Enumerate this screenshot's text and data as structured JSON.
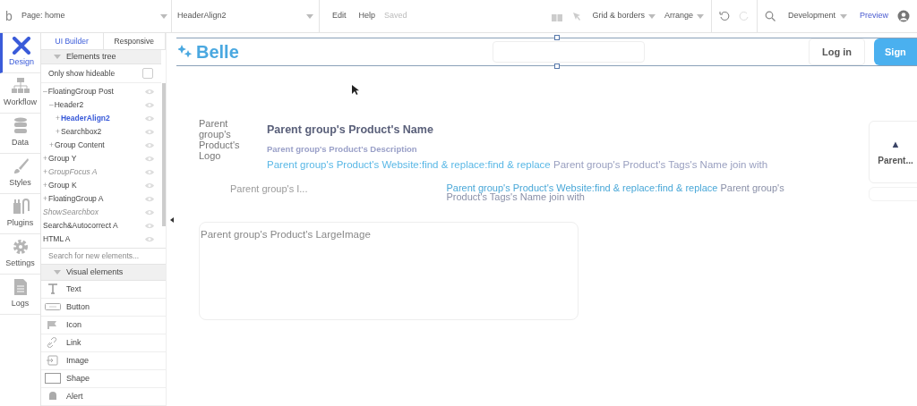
{
  "topbar": {
    "logo": "b",
    "page_select": "Page: home",
    "element_select": "HeaderAlign2",
    "menus": [
      "Edit",
      "Help"
    ],
    "save_status": "Saved",
    "grid_menu": "Grid & borders",
    "arrange_menu": "Arrange",
    "env_menu": "Development",
    "preview": "Preview"
  },
  "rail": [
    {
      "label": "Design",
      "selected": true
    },
    {
      "label": "Workflow",
      "selected": false
    },
    {
      "label": "Data",
      "selected": false
    },
    {
      "label": "Styles",
      "selected": false
    },
    {
      "label": "Plugins",
      "selected": false
    },
    {
      "label": "Settings",
      "selected": false
    },
    {
      "label": "Logs",
      "selected": false
    }
  ],
  "panel_tabs": [
    {
      "label": "UI Builder",
      "selected": true
    },
    {
      "label": "Responsive",
      "selected": false
    }
  ],
  "elements_tree": {
    "title": "Elements tree",
    "filter": {
      "label": "Only show hideable",
      "checked": false
    },
    "items": [
      {
        "marker": "–",
        "label": "FloatingGroup Post",
        "selected": false,
        "hidden": false,
        "children": [
          {
            "marker": "–",
            "label": "Header2",
            "selected": false,
            "hidden": false,
            "children": [
              {
                "marker": "+",
                "label": "HeaderAlign2",
                "selected": true,
                "hidden": false
              },
              {
                "marker": "+",
                "label": "Searchbox2",
                "selected": false,
                "hidden": false
              }
            ]
          },
          {
            "marker": "+",
            "label": "Group Content",
            "selected": false,
            "hidden": false
          }
        ]
      },
      {
        "marker": "+",
        "label": "Group Y",
        "selected": false,
        "hidden": false
      },
      {
        "marker": "+",
        "label": "GroupFocus A",
        "selected": false,
        "hidden": true
      },
      {
        "marker": "+",
        "label": "Group K",
        "selected": false,
        "hidden": false
      },
      {
        "marker": "+",
        "label": "FloatingGroup A",
        "selected": false,
        "hidden": false
      },
      {
        "label": "ShowSearchbox",
        "selected": false,
        "hidden": true
      },
      {
        "label": "Search&Autocorrect A",
        "selected": false,
        "hidden": false
      },
      {
        "label": "HTML A",
        "selected": false,
        "hidden": false
      }
    ]
  },
  "element_search": {
    "placeholder": "Search for new elements..."
  },
  "visual_elements": {
    "title": "Visual elements",
    "items": [
      {
        "label": "Text",
        "kind": "text"
      },
      {
        "label": "Button",
        "kind": "button"
      },
      {
        "label": "Icon",
        "kind": "icon"
      },
      {
        "label": "Link",
        "kind": "link"
      },
      {
        "label": "Image",
        "kind": "image"
      },
      {
        "label": "Shape",
        "kind": "shape"
      },
      {
        "label": "Alert",
        "kind": "alert"
      }
    ]
  },
  "canvas": {
    "header": {
      "logo": "Belle",
      "login": "Log in",
      "signup": "Sign"
    },
    "product": {
      "logo": "Parent group's Product's Logo",
      "name": "Parent group's Product's Name",
      "description": "Parent group's Product's Description",
      "website": "Parent group's Product's Website:find & replace:find & replace",
      "tags": "Parent group's Product's Tags's Name join with"
    },
    "faded_row": {
      "title": "Parent group's I...",
      "website": "Parent group's Product's Website:find & replace:find & replace",
      "tags_start": "Parent group's",
      "tags_end": "Product's Tags's Name join with"
    },
    "vote_card": {
      "arrow": "▲",
      "label": "Parent..."
    },
    "large_image": "Parent group's Product's LargeImage"
  }
}
